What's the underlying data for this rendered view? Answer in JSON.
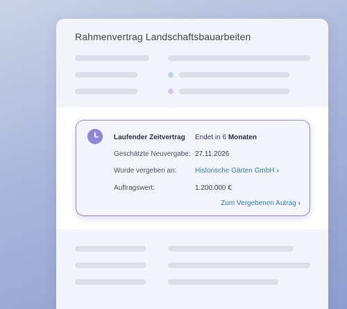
{
  "panel": {
    "title": "Rahmenvertrag Landschaftsbauarbeiten"
  },
  "colors": {
    "accent": "#8f86d6",
    "link": "#2f7fa6",
    "dot_blue": "#b9d4e6",
    "dot_purple": "#d5c4ef",
    "placeholder": "#dcdee8"
  },
  "card": {
    "heading": "Laufender Zeitvertrag",
    "status_prefix": "Endet in 6",
    "status_bold": "Monaten",
    "renewal_label": "Geschätzte Neuvergabe:",
    "renewal_value": "27.11.2026",
    "awarded_label": "Wurde vergeben an:",
    "awarded_value": "Historische Gärten GmbH",
    "value_label": "Auftragswert:",
    "value_value": "1.200.000 €",
    "cta_label": "Zum Vergebenen Autrag",
    "icon": "clock-icon"
  }
}
